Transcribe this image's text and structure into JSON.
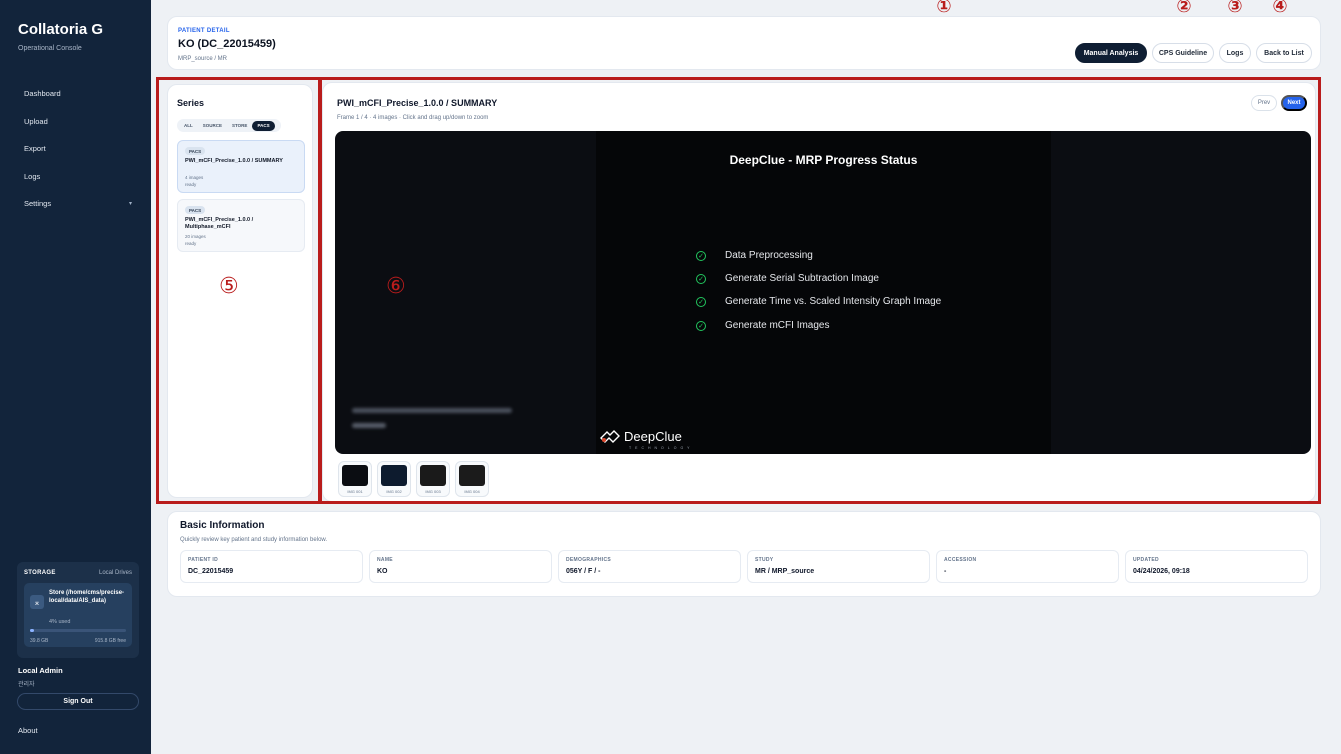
{
  "sidebar": {
    "brand": "Collatoria G",
    "subtitle": "Operational Console",
    "nav": [
      {
        "label": "Dashboard"
      },
      {
        "label": "Upload"
      },
      {
        "label": "Export"
      },
      {
        "label": "Logs"
      },
      {
        "label": "Settings",
        "caret": "▾"
      }
    ],
    "storage": {
      "title": "STORAGE",
      "right": "Local Drives",
      "drive_name": "Store (/home/cms/precise-local/data/AIS_data)",
      "used_label": "4% used",
      "used_pct": 4,
      "used": "39.8 GB",
      "free": "915.8 GB free"
    },
    "user": {
      "name": "Local Admin",
      "role": "관리자"
    },
    "sign_out": "Sign Out",
    "about": "About"
  },
  "header": {
    "label": "PATIENT DETAIL",
    "title": "KO (DC_22015459)",
    "subtitle": "MRP_source / MR",
    "buttons": {
      "manual": "Manual Analysis",
      "cps": "CPS Guideline",
      "logs": "Logs",
      "back": "Back to List"
    },
    "annotations": [
      "①",
      "②",
      "③",
      "④"
    ]
  },
  "series": {
    "title": "Series",
    "filters": [
      "ALL",
      "SOURCE",
      "STORE",
      "PACS"
    ],
    "active_filter": "PACS",
    "items": [
      {
        "tag": "PACS",
        "name": "PWI_mCFI_Precise_1.0.0 / SUMMARY",
        "count": "4 images",
        "status": "ready"
      },
      {
        "tag": "PACS",
        "name": "PWI_mCFI_Precise_1.0.0 / Multiphase_mCFI",
        "count": "20 images",
        "status": "ready"
      }
    ],
    "annotation": "⑤"
  },
  "viewer": {
    "title": "PWI_mCFI_Precise_1.0.0 / SUMMARY",
    "subtitle": "Frame 1 / 4 · 4 images · Click and drag up/down to zoom",
    "prev": "Prev",
    "next": "Next",
    "annotation": "⑥",
    "image": {
      "heading": "DeepClue - MRP Progress Status",
      "steps": [
        "Data Preprocessing",
        "Generate Serial Subtraction Image",
        "Generate Time vs. Scaled Intensity Graph Image",
        "Generate mCFI Images"
      ],
      "logo": "DeepClue",
      "logo_sub": "TECHNOLOGY"
    },
    "thumbs": [
      "IMG 001",
      "IMG 002",
      "IMG 003",
      "IMG 004"
    ]
  },
  "basic": {
    "title": "Basic Information",
    "subtitle": "Quickly review key patient and study information below.",
    "fields": [
      {
        "label": "PATIENT ID",
        "value": "DC_22015459"
      },
      {
        "label": "NAME",
        "value": "KO"
      },
      {
        "label": "DEMOGRAPHICS",
        "value": "056Y / F / -"
      },
      {
        "label": "STUDY",
        "value": "MR / MRP_source"
      },
      {
        "label": "ACCESSION",
        "value": "-"
      },
      {
        "label": "UPDATED",
        "value": "04/24/2026, 09:18"
      }
    ]
  },
  "colors": {
    "sidebar": "#12243b",
    "accent": "#2563eb",
    "annotation": "#b91c1c",
    "success": "#22c55e"
  }
}
